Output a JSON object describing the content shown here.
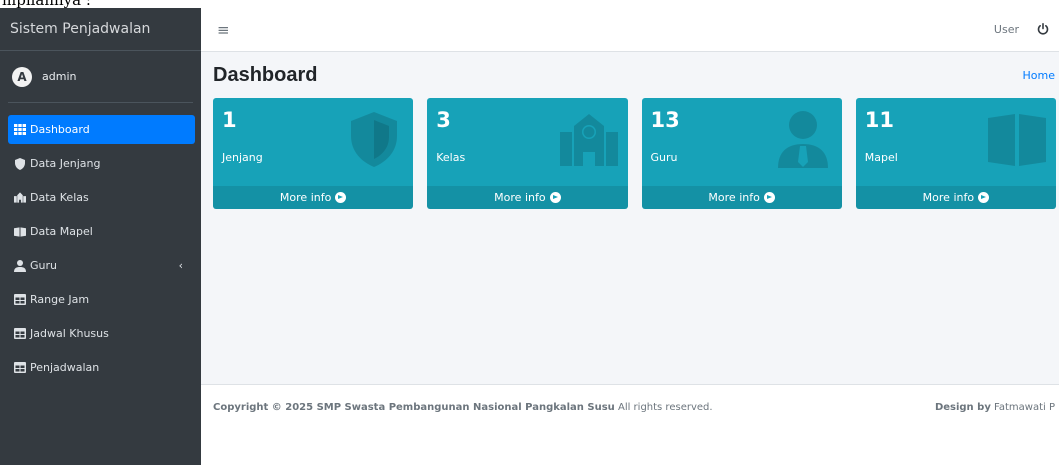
{
  "cropped_caption": "mpilannya :",
  "sidebar": {
    "brand": "Sistem Penjadwalan",
    "user": {
      "avatar_letter": "A",
      "name": "admin"
    },
    "items": [
      {
        "label": "Dashboard",
        "icon": "grid-icon",
        "active": true
      },
      {
        "label": "Data Jenjang",
        "icon": "shield-icon"
      },
      {
        "label": "Data Kelas",
        "icon": "school-icon"
      },
      {
        "label": "Data Mapel",
        "icon": "book-icon"
      },
      {
        "label": "Guru",
        "icon": "user-icon",
        "has_children": true
      },
      {
        "label": "Range Jam",
        "icon": "table-icon"
      },
      {
        "label": "Jadwal Khusus",
        "icon": "table-icon"
      },
      {
        "label": "Penjadwalan",
        "icon": "table-icon"
      }
    ]
  },
  "navbar": {
    "menu_icon": "hamburger-icon",
    "user_label": "User",
    "power_icon": "power-icon"
  },
  "header": {
    "title": "Dashboard",
    "breadcrumb": "Home"
  },
  "stats": [
    {
      "value": "1",
      "label": "Jenjang",
      "more": "More info",
      "icon": "shield-icon"
    },
    {
      "value": "3",
      "label": "Kelas",
      "more": "More info",
      "icon": "school-icon"
    },
    {
      "value": "13",
      "label": "Guru",
      "more": "More info",
      "icon": "user-tie-icon"
    },
    {
      "value": "11",
      "label": "Mapel",
      "more": "More info",
      "icon": "book-open-icon"
    }
  ],
  "footer": {
    "copyright_prefix": "Copyright © 2025 SMP Swasta Pembangunan Nasional Pangkalan Susu",
    "copyright_suffix": " All rights reserved.",
    "design_prefix": "Design by",
    "design_name": " Fatmawati P"
  },
  "colors": {
    "sidebar": "#343a40",
    "active": "#007bff",
    "box": "#17a2b8",
    "link": "#007bff"
  }
}
